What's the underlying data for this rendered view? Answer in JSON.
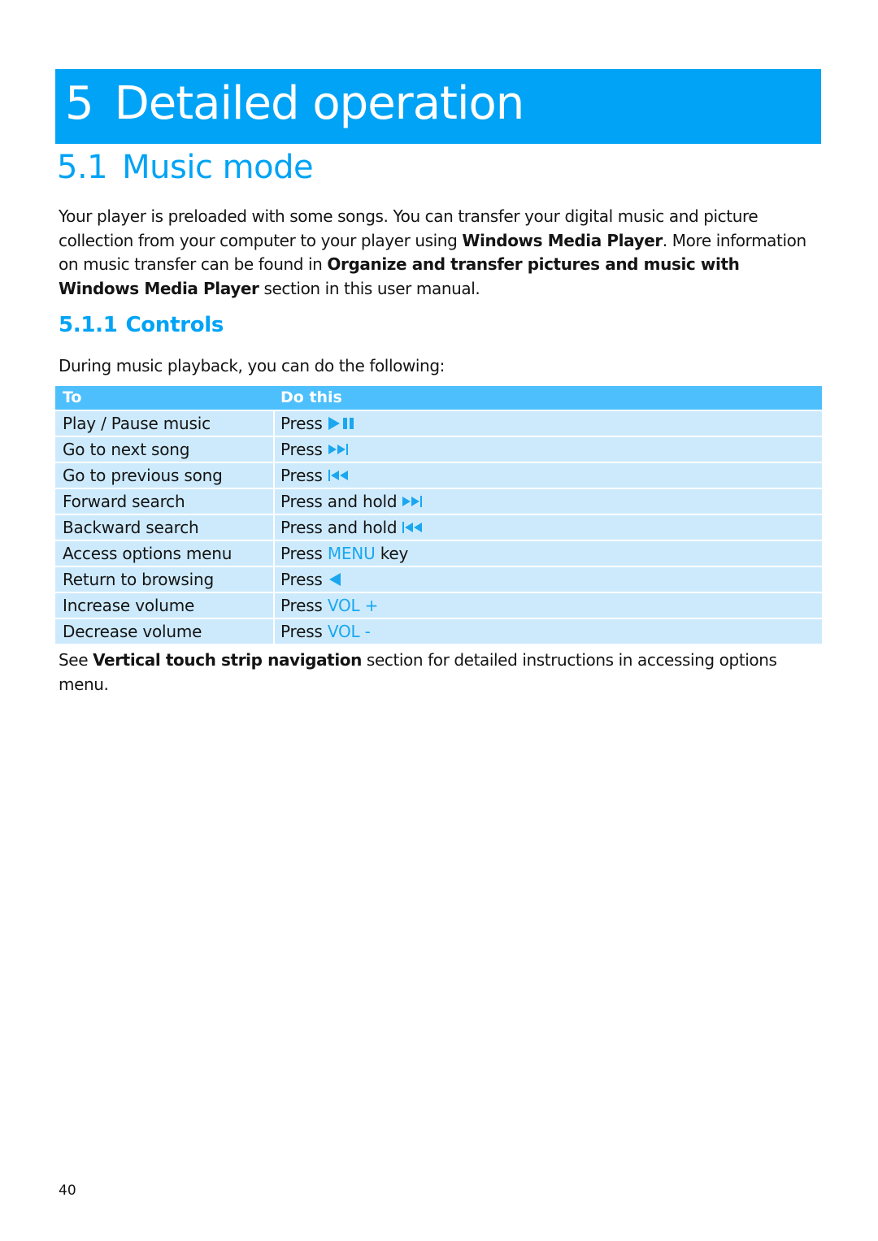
{
  "chapter": {
    "number": "5",
    "title": "Detailed operation"
  },
  "section": {
    "number": "5.1",
    "title": "Music mode"
  },
  "intro": {
    "part1": "Your player is preloaded with some songs. You can transfer your digital music and picture collection from your computer to your player using ",
    "bold1": "Windows Media Player",
    "part2": ". More information on music transfer can be found in ",
    "bold2": "Organize and transfer pictures and music with Windows Media Player",
    "part3": " section in this user manual."
  },
  "subsection": {
    "number": "5.1.1",
    "title": "Controls"
  },
  "lead": "During music playback, you can do the following:",
  "table": {
    "headers": {
      "to": "To",
      "do_this": "Do this"
    },
    "rows": [
      {
        "to": "Play / Pause music",
        "action": "Press",
        "icon": "play-pause-icon"
      },
      {
        "to": "Go to next song",
        "action": "Press",
        "icon": "next-track-icon"
      },
      {
        "to": "Go to previous song",
        "action": "Press",
        "icon": "previous-track-icon"
      },
      {
        "to": "Forward search",
        "action": "Press and hold",
        "icon": "next-track-icon"
      },
      {
        "to": "Backward search",
        "action": "Press and hold",
        "icon": "previous-track-icon"
      },
      {
        "to": "Access options menu",
        "action": "Press",
        "key": "MENU",
        "suffix": "key"
      },
      {
        "to": "Return to browsing",
        "action": "Press",
        "icon": "back-arrow-icon"
      },
      {
        "to": "Increase volume",
        "action": "Press",
        "key": "VOL +"
      },
      {
        "to": "Decrease volume",
        "action": "Press",
        "key": "VOL -"
      }
    ]
  },
  "note": {
    "part1": "See ",
    "bold": "Vertical touch strip navigation",
    "part2": " section for detailed instructions in accessing options menu."
  },
  "page_number": "40",
  "colors": {
    "brand_blue": "#00a3f5",
    "table_header": "#4dbffc",
    "table_row": "#cdeafc",
    "key_text": "#1aa7f0"
  }
}
